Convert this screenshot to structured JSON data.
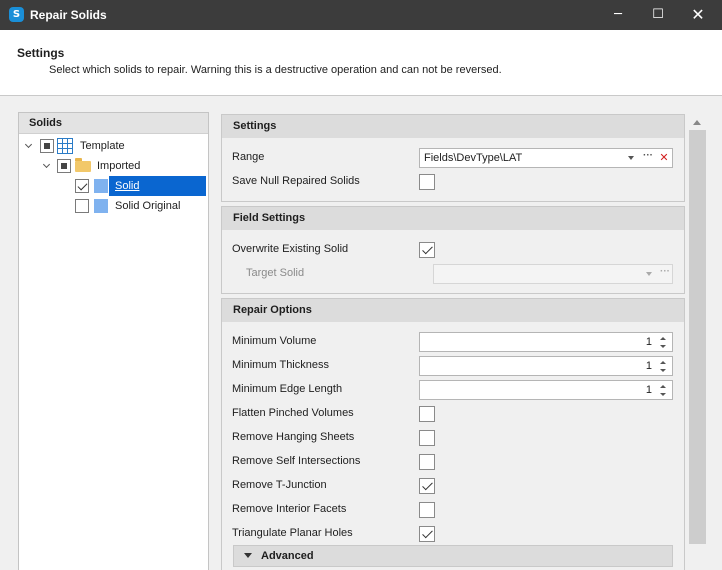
{
  "window": {
    "title": "Repair Solids",
    "icon": "app-logo-icon",
    "controls": {
      "minimize": "─",
      "maximize": "☐",
      "close": "✕"
    }
  },
  "header": {
    "title": "Settings",
    "description": "Select which solids to repair. Warning this is a destructive operation and can not be reversed."
  },
  "tree": {
    "header": "Solids",
    "items": [
      {
        "label": "Template",
        "check": "partial",
        "icon": "table-icon",
        "level": 0
      },
      {
        "label": "Imported",
        "check": "partial",
        "icon": "folder-icon",
        "level": 1
      },
      {
        "label": "Solid",
        "check": "checked",
        "icon": "solid-icon",
        "level": 2,
        "selected": true
      },
      {
        "label": "Solid Original",
        "check": "unchecked",
        "icon": "solid-icon",
        "level": 2
      }
    ]
  },
  "settings": {
    "header": "Settings",
    "range_label": "Range",
    "range_value": "Fields\\DevType\\LAT",
    "save_null_label": "Save Null Repaired Solids",
    "save_null_checked": false
  },
  "field_settings": {
    "header": "Field Settings",
    "overwrite_label": "Overwrite Existing Solid",
    "overwrite_checked": true,
    "target_label": "Target Solid",
    "target_value": ""
  },
  "repair_options": {
    "header": "Repair Options",
    "min_volume_label": "Minimum Volume",
    "min_volume": "1",
    "min_thickness_label": "Minimum Thickness",
    "min_thickness": "1",
    "min_edge_label": "Minimum Edge Length",
    "min_edge": "1",
    "checks": [
      {
        "label": "Flatten Pinched Volumes",
        "checked": false
      },
      {
        "label": "Remove Hanging Sheets",
        "checked": false
      },
      {
        "label": "Remove Self Intersections",
        "checked": false
      },
      {
        "label": "Remove T-Junction",
        "checked": true
      },
      {
        "label": "Remove Interior Facets",
        "checked": false
      },
      {
        "label": "Triangulate Planar Holes",
        "checked": true
      }
    ],
    "advanced_label": "Advanced"
  },
  "colors": {
    "titlebar": "#3c3c3c",
    "selection": "#0a66d0",
    "group_header": "#dcdcdc",
    "clear_red": "#d32020"
  }
}
